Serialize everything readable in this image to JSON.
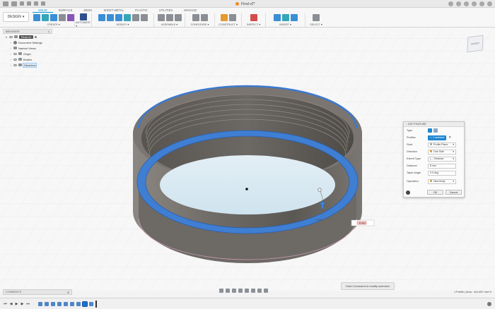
{
  "titlebar": {
    "doc_title": "Final v2*",
    "accent_color": "#f08a24"
  },
  "ribbon": {
    "workspace_label": "DESIGN",
    "tabs": [
      {
        "label": "SOLID",
        "active": true
      },
      {
        "label": "SURFACE",
        "active": false
      },
      {
        "label": "MESH",
        "active": false
      },
      {
        "label": "SHEET METAL",
        "active": false
      },
      {
        "label": "PLASTIC",
        "active": false
      },
      {
        "label": "UTILITIES",
        "active": false
      },
      {
        "label": "MANAGE",
        "active": false
      }
    ],
    "groups": {
      "create": "CREATE ▾",
      "automate": "AUTOMATE ▾",
      "modify": "MODIFY ▾",
      "assemble": "ASSEMBLE ▾",
      "configure": "CONFIGURE ▾",
      "construct": "CONSTRUCT ▾",
      "inspect": "INSPECT ▾",
      "insert": "INSERT ▾",
      "select": "SELECT ▾"
    }
  },
  "browser": {
    "title": "BROWSER",
    "root": "Final v2",
    "items": [
      {
        "label": "Document Settings"
      },
      {
        "label": "Named Views"
      },
      {
        "label": "Origin"
      },
      {
        "label": "Bodies"
      },
      {
        "label": "Sketches"
      }
    ]
  },
  "viewcube": {
    "face": "FRONT"
  },
  "canvas": {
    "dimension_value": "8.00",
    "dimension_input": "8 mm"
  },
  "edit_feature": {
    "title": "EDIT FEATURE",
    "rows": {
      "type": {
        "label": "Type"
      },
      "profiles": {
        "label": "Profiles",
        "value": "1 selected"
      },
      "start": {
        "label": "Start",
        "value": "Profile Plane"
      },
      "direction": {
        "label": "Direction",
        "value": "One Side"
      },
      "extent_type": {
        "label": "Extent Type",
        "value": "Distance"
      },
      "distance": {
        "label": "Distance",
        "value": "8 mm"
      },
      "taper_angle": {
        "label": "Taper Angle",
        "value": "0.0 deg"
      },
      "operation": {
        "label": "Operation",
        "value": "New Body"
      }
    },
    "ok_label": "OK",
    "cancel_label": "Cancel",
    "selection_color": "#1f86d1"
  },
  "hint": "Hold Command to modify selection",
  "comments": {
    "label": "COMMENTS"
  },
  "status": "1 Profile | Area : 441.657 mm^2"
}
